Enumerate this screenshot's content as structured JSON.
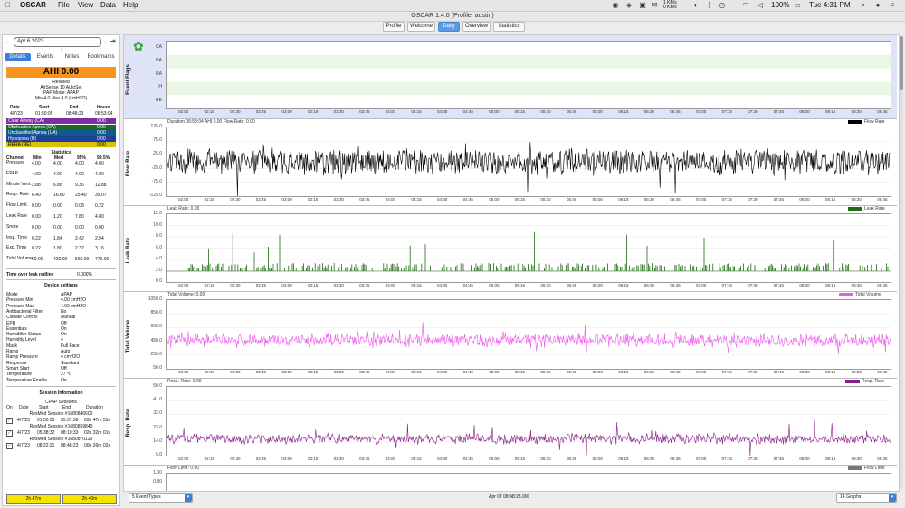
{
  "menubar": {
    "app": "OSCAR",
    "items": [
      "File",
      "View",
      "Data",
      "Help"
    ],
    "net_speed": "1 KB/s\n0 KB/s",
    "battery": "100%",
    "clock": "Tue 4:31 PM"
  },
  "window": {
    "title": "OSCAR 1.4.0 (Profile: austin)"
  },
  "main_tabs": [
    {
      "label": "Profile"
    },
    {
      "label": "Welcome"
    },
    {
      "label": "Daily",
      "active": true
    },
    {
      "label": "Overview"
    },
    {
      "label": "Statistics"
    }
  ],
  "left": {
    "date": "Apr 6 2023",
    "subtabs": [
      "Details",
      "Events",
      "Notes",
      "Bookmarks"
    ],
    "ahi": "AHI 0.00",
    "machine_lines": [
      "ResMed",
      "AirSense 10 AutoSet",
      "PAP Mode: APAP",
      "Min 4.0 Max 4.0 (cmH2O)"
    ],
    "session_header": [
      "Date",
      "Start",
      "End",
      "Hours"
    ],
    "session_row": [
      "4/7/23",
      "01:50:05",
      "08:48:23",
      "06:53:04"
    ],
    "events": [
      {
        "label": "Clear Airway (CA)",
        "value": "0.00",
        "color": "#7b2fa0"
      },
      {
        "label": "Obstructive Apnea (OA)",
        "value": "0.00",
        "color": "#1b6a2a"
      },
      {
        "label": "Unclassified Apnea (UA)",
        "value": "0.00",
        "color": "#0f5a8a"
      },
      {
        "label": "Hypopnea (H)",
        "value": "0.00",
        "color": "#1c3f9a"
      },
      {
        "label": "RERA (RE)",
        "value": "0.00",
        "color": "#d8c10a",
        "text_color": "#000"
      }
    ],
    "stats_title": "Statistics",
    "stats_header": [
      "Channel",
      "Min",
      "Med",
      "95%",
      "99.5%"
    ],
    "stats_rows": [
      [
        "Pressure",
        "4.00",
        "4.00",
        "4.00",
        "4.00"
      ],
      [
        "EPAP",
        "4.00",
        "4.00",
        "4.00",
        "4.00"
      ],
      [
        "Minute Vent.",
        "2.88",
        "6.88",
        "9.36",
        "12.88"
      ],
      [
        "Resp. Rate",
        "6.40",
        "16.80",
        "25.40",
        "35.07"
      ],
      [
        "Flow Limit.",
        "0.00",
        "0.00",
        "0.08",
        "0.22"
      ],
      [
        "Leak Rate",
        "0.00",
        "1.20",
        "7.80",
        "4.80"
      ],
      [
        "Snore",
        "0.00",
        "0.00",
        "0.00",
        "0.00"
      ],
      [
        "Insp. Time",
        "0.22",
        "1.84",
        "2.42",
        "2.94"
      ],
      [
        "Exp. Time",
        "0.22",
        "1.80",
        "2.32",
        "3.16"
      ],
      [
        "Tidal Volume",
        "60.00",
        "420.00",
        "560.00",
        "770.00"
      ]
    ],
    "leak_redline_label": "Time over leak redline",
    "leak_redline_value": "0.000%",
    "device_title": "Device settings",
    "device_settings": [
      [
        "Mode",
        "APAP"
      ],
      [
        "Pressure Min",
        "4.00 cmH2O"
      ],
      [
        "Pressure Max",
        "4.00 cmH2O"
      ],
      [
        "Antibacterial Filter",
        "No"
      ],
      [
        "Climate Control",
        "Manual"
      ],
      [
        "EPR",
        "Off"
      ],
      [
        "Essentials",
        "On"
      ],
      [
        "Humidifier Status",
        "On"
      ],
      [
        "Humidity Level",
        "4"
      ],
      [
        "Mask",
        "Full Face"
      ],
      [
        "Ramp",
        "Auto"
      ],
      [
        "Ramp Pressure",
        "4 cmH2O"
      ],
      [
        "Response",
        "Standard"
      ],
      [
        "Smart Start",
        "Off"
      ],
      [
        "Temperature",
        "27 ºC"
      ],
      [
        "Temperature Enable",
        "On"
      ]
    ],
    "session_info_title": "Session Information",
    "cpap_sessions": "CPAP Sessions",
    "sessions_header": [
      "On",
      "Date",
      "Start",
      "End",
      "Duration"
    ],
    "sessions": [
      {
        "title": "ResMed Session #1680846600",
        "row": [
          "4/7/23",
          "01:50:05",
          "05:37:58",
          "03h 47m 53s"
        ]
      },
      {
        "title": "ResMed Session #1680859840",
        "row": [
          "4/7/23",
          "05:38:32",
          "08:10:33",
          "02h 32m 01s"
        ]
      },
      {
        "title": "ResMed Session #1680870120",
        "row": [
          "4/7/23",
          "08:22:21",
          "08:48:23",
          "00h 26m 02s"
        ]
      }
    ],
    "bottom_boxes": [
      "2h 47m",
      "2h 40m"
    ]
  },
  "graphs": {
    "time_ticks": [
      "02:00",
      "02:15",
      "02:30",
      "02:45",
      "03:00",
      "03:15",
      "03:30",
      "03:45",
      "04:00",
      "04:15",
      "04:30",
      "04:45",
      "05:00",
      "05:15",
      "05:30",
      "05:45",
      "06:00",
      "06:15",
      "06:30",
      "06:45",
      "07:00",
      "07:15",
      "07:30",
      "07:45",
      "08:00",
      "08:15",
      "08:30",
      "08:45"
    ],
    "event_flags": {
      "ylabel": "Event Flags",
      "rows": [
        "CA",
        "OA",
        "UA",
        "H",
        "RE"
      ]
    },
    "flow_rate": {
      "header": "Duration 06:53:04 AHI 0.00 Flow Rate: 0.00",
      "legend": "Flow Rate",
      "ylabel": "Flow Rate",
      "yticks": [
        "125.0",
        "75.0",
        "25.0",
        "-25.0",
        "-75.0",
        "-125.0"
      ],
      "color": "#000000"
    },
    "leak_rate": {
      "header": "Leak Rate: 0.00",
      "legend": "Leak Rate",
      "ylabel": "Leak Rate",
      "yticks": [
        "12.0",
        "10.0",
        "8.0",
        "6.0",
        "4.0",
        "2.0",
        "0.0"
      ],
      "color": "#1f6b12"
    },
    "tidal_volume": {
      "header": "Tidal Volume: 0.00",
      "legend": "Tidal Volume",
      "ylabel": "Tidal Volume",
      "yticks": [
        "1050.0",
        "850.0",
        "650.0",
        "450.0",
        "250.0",
        "50.0"
      ],
      "color": "#ee55ee"
    },
    "resp_rate": {
      "header": "Resp. Rate: 0.00",
      "legend": "Resp. Rate",
      "ylabel": "Resp. Rate",
      "yticks": [
        "50.0",
        "41.0",
        "32.0",
        "23.0",
        "14.0",
        "5.0"
      ],
      "color": "#8a1d8a"
    },
    "flow_limit": {
      "header": "Flow Limit: 0.00",
      "legend": "Flow Limit",
      "yticks": [
        "1.00",
        "0.80"
      ],
      "color": "#777777"
    }
  },
  "footer": {
    "event_types": "5 Event Types",
    "timestamp": "Apr 07 08:48:23.000",
    "graphs": "14 Graphs"
  }
}
